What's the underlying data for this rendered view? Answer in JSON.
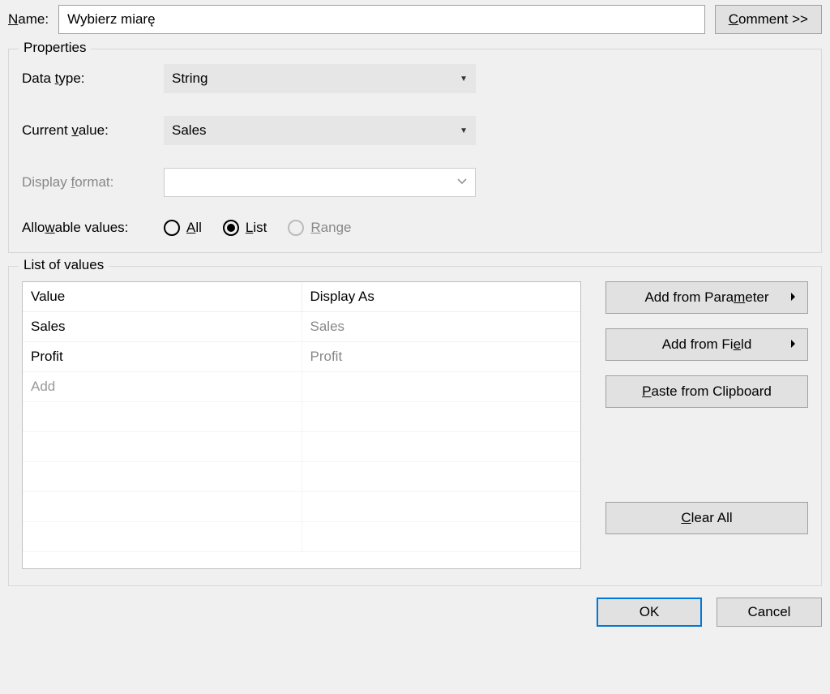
{
  "name_label_pre": "N",
  "name_label_post": "ame:",
  "name_value": "Wybierz miarę",
  "comment_pre": "C",
  "comment_post": "omment >>",
  "properties": {
    "legend": "Properties",
    "data_type_pre": "Data ",
    "data_type_u": "t",
    "data_type_post": "ype:",
    "data_type_value": "String",
    "current_value_pre": "Current ",
    "current_value_u": "v",
    "current_value_post": "alue:",
    "current_value_value": "Sales",
    "display_format_pre": "Display ",
    "display_format_u": "f",
    "display_format_post": "ormat:",
    "display_format_value": "",
    "allowable_pre": "Allo",
    "allowable_u": "w",
    "allowable_post": "able values:",
    "radio_all_u": "A",
    "radio_all_post": "ll",
    "radio_list_u": "L",
    "radio_list_post": "ist",
    "radio_range_u": "R",
    "radio_range_post": "ange"
  },
  "list": {
    "legend": "List of values",
    "col_value": "Value",
    "col_display": "Display As",
    "rows": [
      {
        "value": "Sales",
        "display": "Sales"
      },
      {
        "value": "Profit",
        "display": "Profit"
      }
    ],
    "add_placeholder": "Add",
    "btn_param_pre": "Add from Para",
    "btn_param_u": "m",
    "btn_param_post": "eter",
    "btn_field_pre": "Add from Fi",
    "btn_field_u": "e",
    "btn_field_post": "ld",
    "btn_paste_u": "P",
    "btn_paste_post": "aste from Clipboard",
    "btn_clear_u": "C",
    "btn_clear_post": "lear All"
  },
  "footer": {
    "ok": "OK",
    "cancel": "Cancel"
  }
}
